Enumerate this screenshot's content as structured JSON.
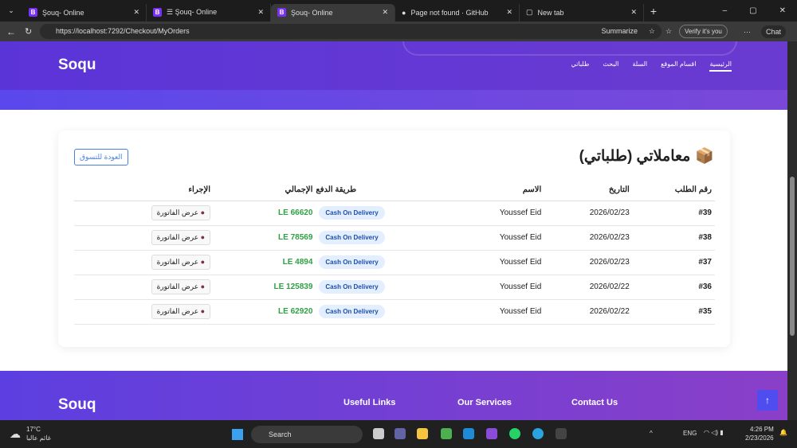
{
  "browser": {
    "tabs": [
      {
        "title": "Şouq- Online"
      },
      {
        "title": "☰ Şouq- Online"
      },
      {
        "title": "Şouq- Online"
      },
      {
        "title": "Page not found · GitHub"
      },
      {
        "title": "New tab"
      }
    ],
    "url": "https://localhost:7292/Checkout/MyOrders",
    "summarize": "Summarize",
    "verify": "Verify it's you",
    "chat": "Chat"
  },
  "header": {
    "logo": "Soqu",
    "nav": [
      "الرئيسية",
      "اقسام الموقع",
      "السلة",
      "البحث",
      "طلباتي"
    ]
  },
  "orders": {
    "title": "معاملاتي (طلباتي)",
    "back": "العودة للتسوق",
    "columns": [
      "رقم الطلب",
      "التاريخ",
      "الاسم",
      "طريقة الدفع",
      "الإجمالي",
      "الإجراء"
    ],
    "rows": [
      {
        "id": "#39",
        "date": "2026/02/23",
        "name": "Youssef Eid",
        "payment": "Cash On Delivery",
        "total": "LE 66620",
        "action": "عرض الفاتورة"
      },
      {
        "id": "#38",
        "date": "2026/02/23",
        "name": "Youssef Eid",
        "payment": "Cash On Delivery",
        "total": "LE 78569",
        "action": "عرض الفاتورة"
      },
      {
        "id": "#37",
        "date": "2026/02/23",
        "name": "Youssef Eid",
        "payment": "Cash On Delivery",
        "total": "LE 4894",
        "action": "عرض الفاتورة"
      },
      {
        "id": "#36",
        "date": "2026/02/22",
        "name": "Youssef Eid",
        "payment": "Cash On Delivery",
        "total": "LE 125839",
        "action": "عرض الفاتورة"
      },
      {
        "id": "#35",
        "date": "2026/02/22",
        "name": "Youssef Eid",
        "payment": "Cash On Delivery",
        "total": "LE 62920",
        "action": "عرض الفاتورة"
      }
    ]
  },
  "footer": {
    "logo": "Souq",
    "cols": [
      "Useful Links",
      "Our Services",
      "Contact Us"
    ]
  },
  "taskbar": {
    "temp": "17°C",
    "weather": "غائم عالبا",
    "search": "Search",
    "lang": "ENG",
    "time": "4:26 PM",
    "date": "2/23/2026"
  }
}
